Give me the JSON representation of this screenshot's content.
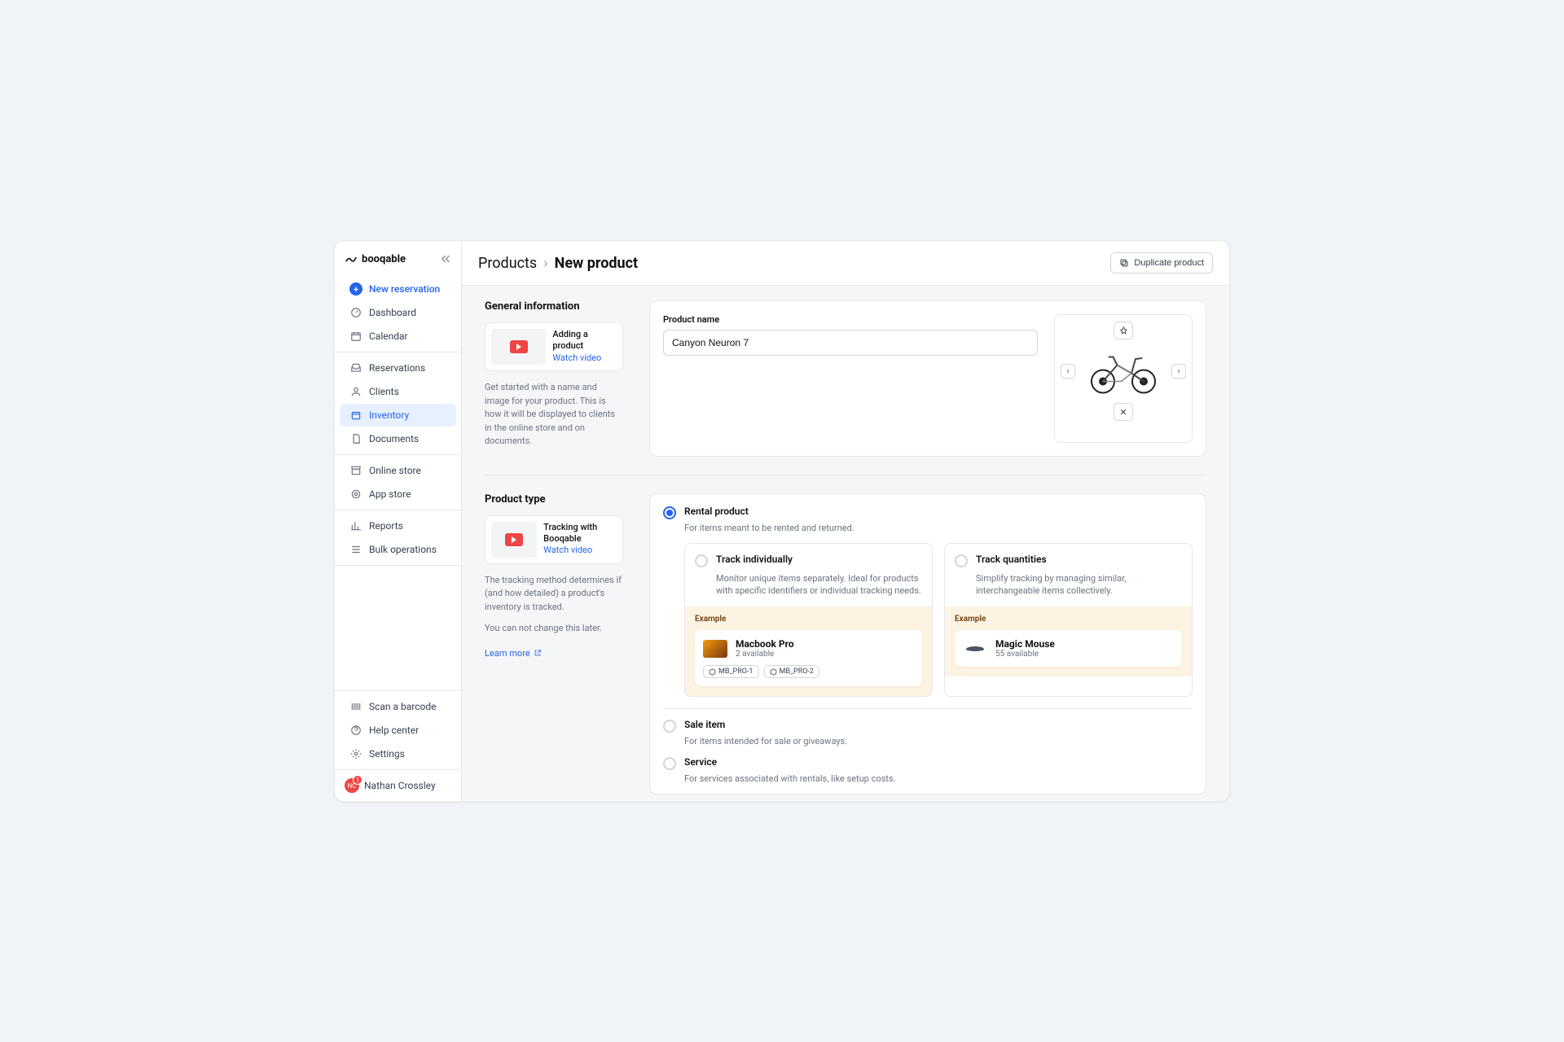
{
  "brand": "booqable",
  "sidebar": {
    "new_reservation": "New reservation",
    "items": [
      {
        "label": "Dashboard"
      },
      {
        "label": "Calendar"
      },
      {
        "label": "Reservations"
      },
      {
        "label": "Clients"
      },
      {
        "label": "Inventory"
      },
      {
        "label": "Documents"
      },
      {
        "label": "Online store"
      },
      {
        "label": "App store"
      },
      {
        "label": "Reports"
      },
      {
        "label": "Bulk operations"
      }
    ],
    "footer": [
      {
        "label": "Scan a barcode"
      },
      {
        "label": "Help center"
      },
      {
        "label": "Settings"
      }
    ],
    "user": {
      "initials": "NC",
      "name": "Nathan Crossley",
      "badge": "1"
    }
  },
  "breadcrumb": {
    "root": "Products",
    "current": "New product"
  },
  "actions": {
    "duplicate": "Duplicate product"
  },
  "general": {
    "title": "General information",
    "video_title": "Adding a product",
    "video_link": "Watch video",
    "help": "Get started with a name and image for your product. This is how it will be displayed to clients in the online store and on documents.",
    "name_label": "Product name",
    "name_value": "Canyon Neuron 7"
  },
  "ptype": {
    "title": "Product type",
    "video_title": "Tracking with Booqable",
    "video_link": "Watch video",
    "help1": "The tracking method determines if (and how detailed) a product's inventory is tracked.",
    "help2": "You can not change this later.",
    "learn": "Learn more",
    "rental": {
      "label": "Rental product",
      "desc": "For items meant to be rented and returned."
    },
    "track_ind": {
      "label": "Track individually",
      "desc": "Monitor unique items separately. Ideal for products with specific identifiers or individual tracking needs.",
      "example_label": "Example",
      "name": "Macbook Pro",
      "avail": "2 available",
      "tag1": "MB_PRO-1",
      "tag2": "MB_PRO-2"
    },
    "track_qty": {
      "label": "Track quantities",
      "desc": "Simplify tracking by managing similar, interchangeable items collectively.",
      "example_label": "Example",
      "name": "Magic Mouse",
      "avail": "55 available"
    },
    "sale": {
      "label": "Sale item",
      "desc": "For items intended for sale or giveaways."
    },
    "service": {
      "label": "Service",
      "desc": "For services associated with rentals, like setup costs."
    }
  }
}
